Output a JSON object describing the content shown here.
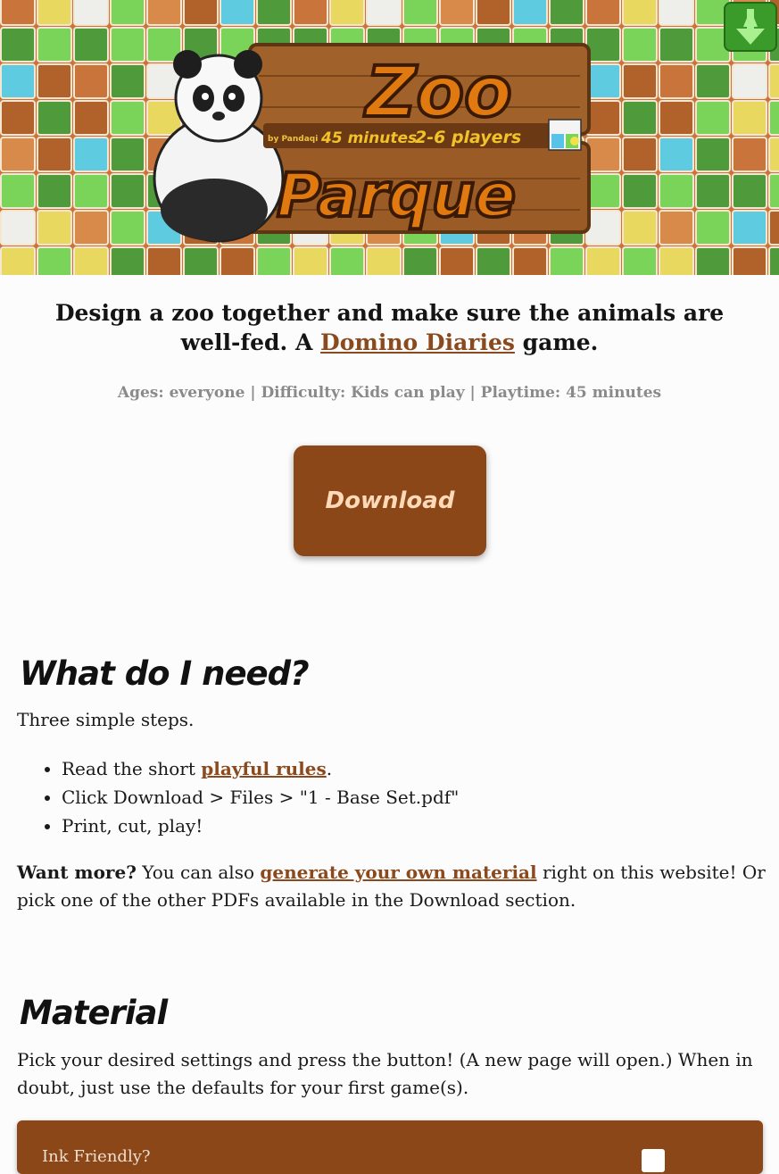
{
  "hero": {
    "logo_line1": "Zoo",
    "logo_line2": "Parque",
    "byline": "by Pandaqi",
    "duration_badge": "45 minutes",
    "players_badge": "2-6 players",
    "series_badge": "Domino Diaries"
  },
  "tagline": {
    "prefix": "Design a zoo together and make sure the animals are well-fed. A ",
    "link": "Domino Diaries",
    "suffix": " game."
  },
  "meta": "Ages: everyone | Difficulty: Kids can play | Playtime: 45 minutes",
  "download_button": "Download",
  "need_section": {
    "heading": "What do I need?",
    "intro": "Three simple steps.",
    "step1_prefix": "Read the short ",
    "step1_link": "playful rules",
    "step1_suffix": ".",
    "step2": "Click Download > Files > \"1 - Base Set.pdf\"",
    "step3": "Print, cut, play!",
    "more_bold": "Want more?",
    "more_prefix": " You can also ",
    "more_link": "generate your own material",
    "more_suffix": " right on this website! Or pick one of the other PDFs available in the Download section."
  },
  "material_section": {
    "heading": "Material",
    "intro": "Pick your desired settings and press the button! (A new page will open.) When in doubt, just use the defaults for your first game(s).",
    "first_setting_label": "Ink Friendly?"
  },
  "colors": {
    "accent_brown": "#8b4718",
    "link_brown": "#8b4a1e",
    "download_text": "#ffd9b8",
    "corner_icon_green": "#3a9a2a"
  }
}
